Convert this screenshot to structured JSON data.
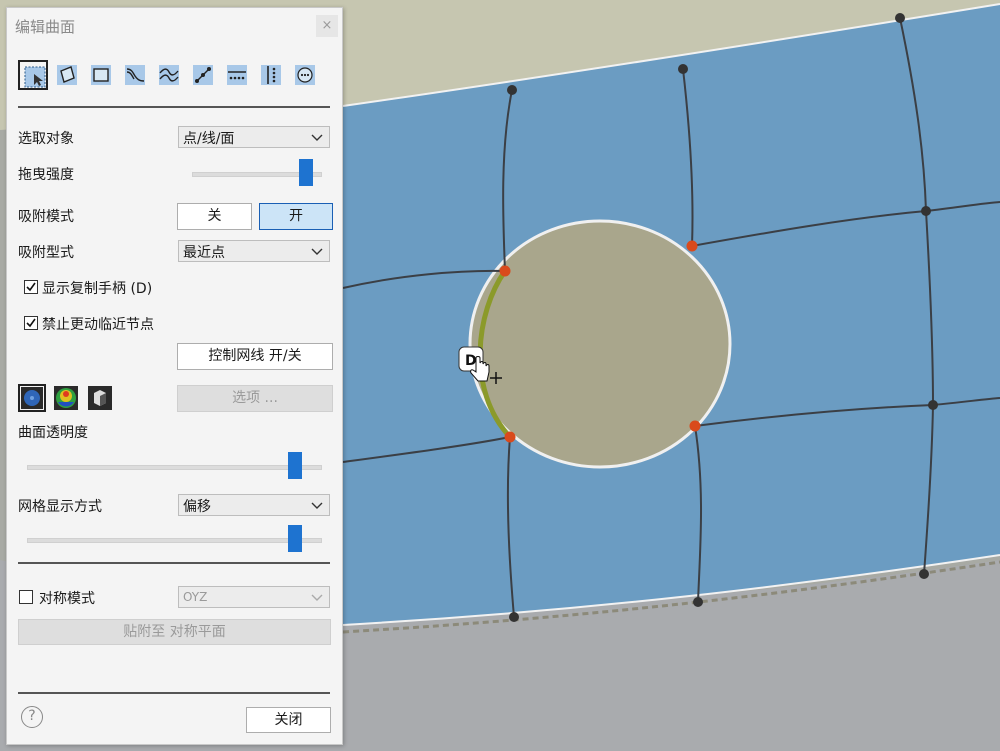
{
  "panel": {
    "title": "编辑曲面",
    "close_glyph": "×",
    "tools": [
      {
        "icon": "select-box-icon",
        "active": true
      },
      {
        "icon": "rotate-face-icon"
      },
      {
        "icon": "square-face-icon"
      },
      {
        "icon": "bend-curve-icon"
      },
      {
        "icon": "wave-lines-icon"
      },
      {
        "icon": "point-line-icon"
      },
      {
        "icon": "edge-points-icon"
      },
      {
        "icon": "split-vertical-icon"
      },
      {
        "icon": "dots-circle-icon"
      }
    ],
    "selection_label": "选取对象",
    "selection_value": "点/线/面",
    "drag_strength_label": "拖曳强度",
    "drag_strength": 0.88,
    "snap_mode_label": "吸附模式",
    "snap_off": "关",
    "snap_on": "开",
    "snap_type_label": "吸附型式",
    "snap_type_value": "最近点",
    "show_copy_handle": "显示复制手柄 (D)",
    "lock_near_nodes": "禁止更动临近节点",
    "control_mesh_button": "控制网线 开/关",
    "options_button": "选项 ...",
    "surface_transparency_label": "曲面透明度",
    "surface_transparency": 0.91,
    "mesh_display_label": "网格显示方式",
    "mesh_display_value": "偏移",
    "mesh_offset": 0.91,
    "symmetry_label": "对称模式",
    "symmetry_plane": "OYZ",
    "snap_to_plane_button": "贴附至 对称平面",
    "help_glyph": "?",
    "close_button": "关闭"
  },
  "viewport": {
    "handle_label": "D"
  }
}
